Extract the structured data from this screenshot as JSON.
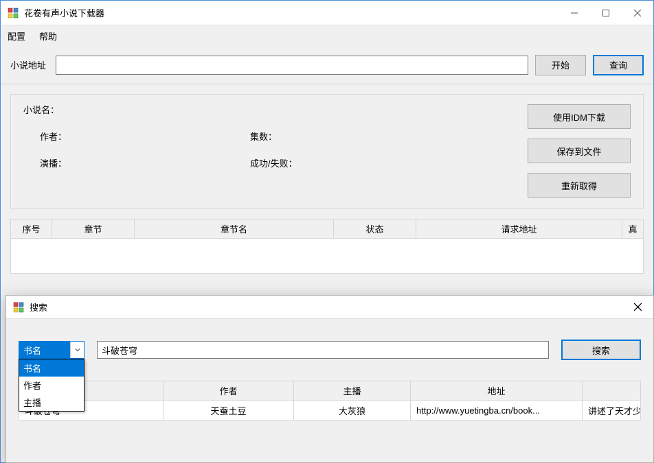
{
  "main": {
    "title": "花卷有声小说下载器",
    "menu": {
      "config": "配置",
      "help": "帮助"
    },
    "addr": {
      "label": "小说地址",
      "value": "",
      "start": "开始",
      "query": "查询"
    },
    "info": {
      "name_label": "小说名：",
      "author_label": "作者：",
      "episodes_label": "集数：",
      "narrator_label": "演播：",
      "status_label": "成功/失败：",
      "idm_btn": "使用IDM下载",
      "save_btn": "保存到文件",
      "refresh_btn": "重新取得"
    },
    "grid_headers": [
      "序号",
      "章节",
      "章节名",
      "状态",
      "请求地址",
      "真"
    ]
  },
  "search": {
    "title": "搜索",
    "combo_selected": "书名",
    "combo_options": [
      "书名",
      "作者",
      "主播"
    ],
    "input_value": "斗破苍穹",
    "search_btn": "搜索",
    "result_headers": [
      "",
      "作者",
      "主播",
      "地址",
      ""
    ],
    "result_row": {
      "name": "斗破苍穹",
      "author": "天蚕土豆",
      "narrator": "大灰狼",
      "url": "http://www.yuetingba.cn/book...",
      "desc": "讲述了天才少"
    }
  }
}
